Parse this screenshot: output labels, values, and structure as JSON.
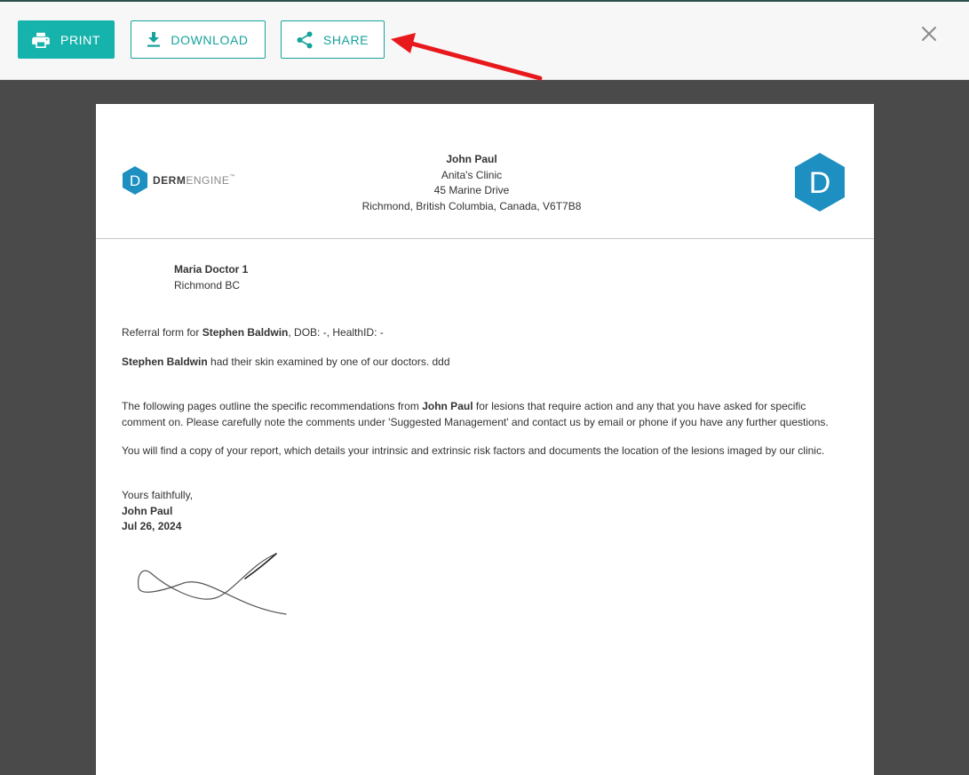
{
  "toolbar": {
    "print_label": "PRINT",
    "download_label": "DOWNLOAD",
    "share_label": "SHARE",
    "accent_color": "#16b3ac"
  },
  "letter": {
    "brand": {
      "word_bold": "DERM",
      "word_light": "ENGINE",
      "mark": "™",
      "badge_letter": "D"
    },
    "sender": {
      "name": "John Paul",
      "clinic": "Anita's Clinic",
      "street": "45 Marine Drive",
      "city": "Richmond, British Columbia, Canada, V6T7B8"
    },
    "recipient": {
      "name": "Maria Doctor 1",
      "location": "Richmond BC"
    },
    "referral": {
      "prefix": "Referral form for ",
      "patient": "Stephen Baldwin",
      "suffix": ", DOB: -, HealthID: -"
    },
    "exam": {
      "patient": "Stephen Baldwin",
      "text": " had their skin examined by one of our doctors. ddd"
    },
    "recommendations": {
      "before": "The following pages outline the specific recommendations from ",
      "doctor": "John Paul",
      "after": " for lesions that require action and any that you have asked for specific comment on. Please carefully note the comments under 'Suggested Management' and contact us by email or phone if you have any further questions."
    },
    "report_note": "You will find a copy of your report, which details your intrinsic and extrinsic risk factors and documents the location of the lesions imaged by our clinic.",
    "closing": {
      "salutation": "Yours faithfully,",
      "name": "John Paul",
      "date": "Jul 26, 2024"
    }
  }
}
